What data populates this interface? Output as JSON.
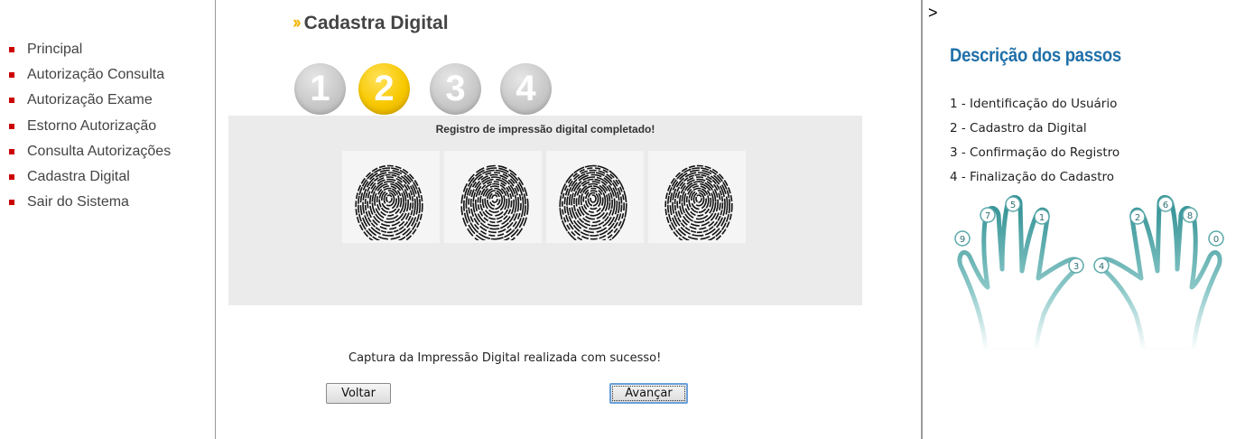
{
  "nav": {
    "items": [
      {
        "label": "Principal"
      },
      {
        "label": "Autorização Consulta"
      },
      {
        "label": "Autorização Exame"
      },
      {
        "label": "Estorno Autorização"
      },
      {
        "label": "Consulta Autorizações"
      },
      {
        "label": "Cadastra Digital"
      },
      {
        "label": "Sair do Sistema"
      }
    ]
  },
  "main": {
    "title": "Cadastra Digital",
    "steps": [
      "1",
      "2",
      "3",
      "4"
    ],
    "active_step": "2",
    "capture_message": "Registro de impressão digital completado!",
    "success_text": "Captura da Impressão Digital realizada com sucesso!",
    "back_label": "Voltar",
    "next_label": "Avançar"
  },
  "right": {
    "stray_text": ">",
    "title": "Descrição dos passos",
    "steps": [
      "1 - Identificação do Usuário",
      "2 - Cadastro da Digital",
      "3 - Confirmação do Registro",
      "4 - Finalização do Cadastro"
    ],
    "finger_numbers": [
      "9",
      "7",
      "5",
      "1",
      "3",
      "4",
      "2",
      "6",
      "8",
      "0"
    ]
  },
  "colors": {
    "nav_bullet": "#cc0000",
    "step_active": "#f7c800",
    "step_inactive": "#c9c9c9",
    "heading_blue": "#1f6fa8",
    "hand_teal": "#4aa3a3"
  },
  "icons": {
    "title_chevron": "double-chevron-right-icon",
    "fingerprint": "fingerprint-icon",
    "hands": "hands-diagram-icon"
  }
}
